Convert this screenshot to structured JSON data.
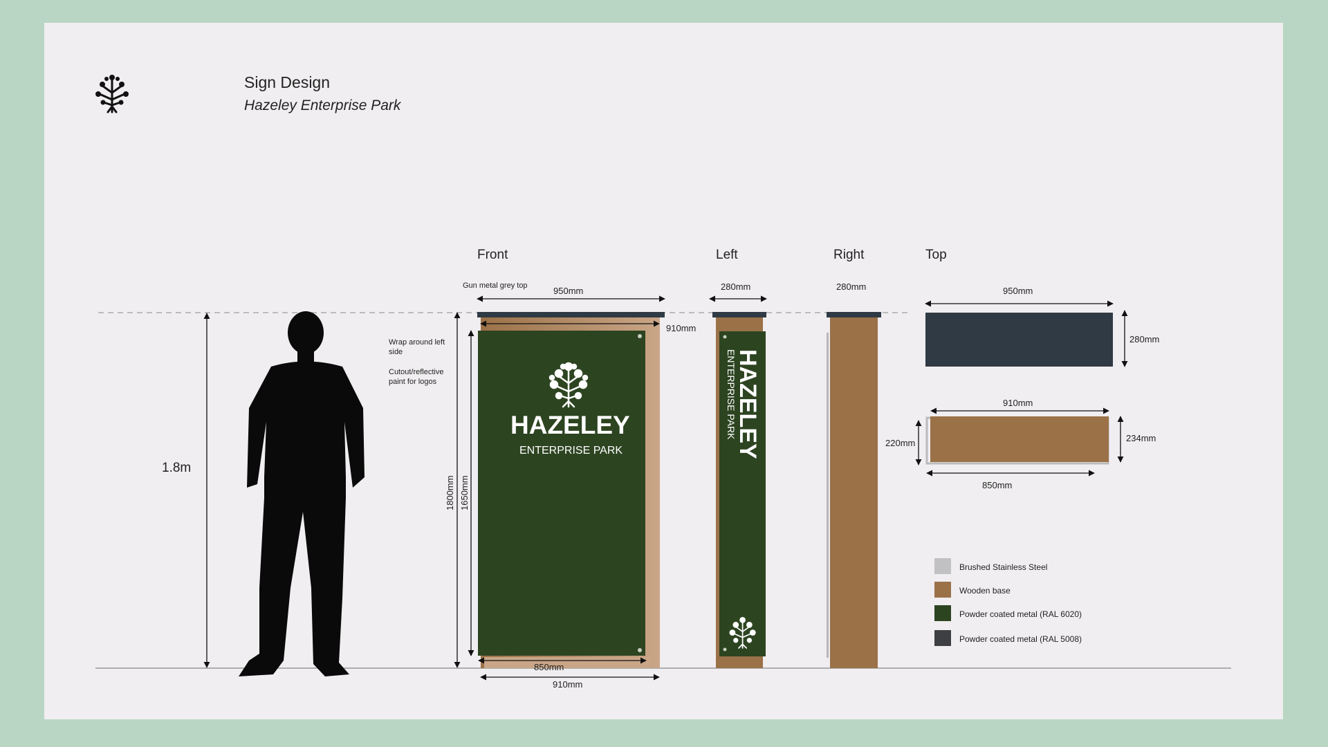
{
  "header": {
    "title": "Sign Design",
    "subtitle": "Hazeley Enterprise Park",
    "logo_icon": "tree-icon"
  },
  "views": {
    "front": "Front",
    "left": "Left",
    "right": "Right",
    "top": "Top"
  },
  "human": {
    "height_label": "1.8m"
  },
  "front_annotations": {
    "top_note": "Gun metal grey top",
    "wrap_note": "Wrap around left side",
    "cutout_note": "Cutout/reflective paint for logos",
    "width_top": "950mm",
    "width_panel": "910mm",
    "height_total": "1800mm",
    "height_panel": "1650mm",
    "width_bottom_inner": "850mm",
    "width_bottom_outer": "910mm"
  },
  "sign_text": {
    "brand": "HAZELEY",
    "tagline": "ENTERPRISE PARK"
  },
  "left_annotations": {
    "depth": "280mm"
  },
  "right_annotations": {
    "depth": "280mm"
  },
  "top_annotations": {
    "cap_width": "950mm",
    "cap_depth": "280mm",
    "base_width_top": "910mm",
    "base_left_depth": "220mm",
    "base_right_depth": "234mm",
    "base_width_bottom": "850mm"
  },
  "legend": [
    {
      "label": "Brushed Stainless Steel",
      "color": "#c1c0c2"
    },
    {
      "label": "Wooden base",
      "color": "#9b7148"
    },
    {
      "label": "Powder coated metal (RAL 6020)",
      "color": "#2d4421"
    },
    {
      "label": "Powder coated metal (RAL 5008)",
      "color": "#3e3f42"
    }
  ],
  "colors": {
    "background": "#b9d6c4",
    "sheet": "#f0eef0",
    "sign_green": "#2d4421",
    "wood": "#9b7148",
    "gunmetal": "#2f3a44"
  }
}
